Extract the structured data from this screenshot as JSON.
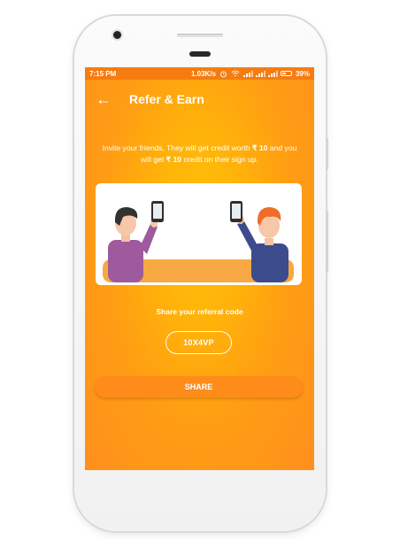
{
  "statusbar": {
    "time": "7:15 PM",
    "speed": "1.03K/s",
    "battery": "39%"
  },
  "toolbar": {
    "back_icon": "←",
    "title": "Refer & Earn"
  },
  "invite": {
    "part1": "Invite your friends, They will get credit worth ",
    "amount1": "₹ 10",
    "part2": " and you will get ",
    "amount2": "₹ 10",
    "part3": " credit on their sign up."
  },
  "referral": {
    "label": "Share your referral code",
    "code": "10X4VP"
  },
  "share_button": {
    "label": "SHARE"
  },
  "colors": {
    "statusbar": "#f57c10",
    "background_center": "#ffc409",
    "background_edge": "#ff8f1d",
    "share_button": "#ff8c1a",
    "couch": "#f7a843"
  },
  "icons": [
    "back-arrow-icon",
    "alarm-icon",
    "wifi-icon",
    "signal-icon",
    "battery-icon"
  ]
}
